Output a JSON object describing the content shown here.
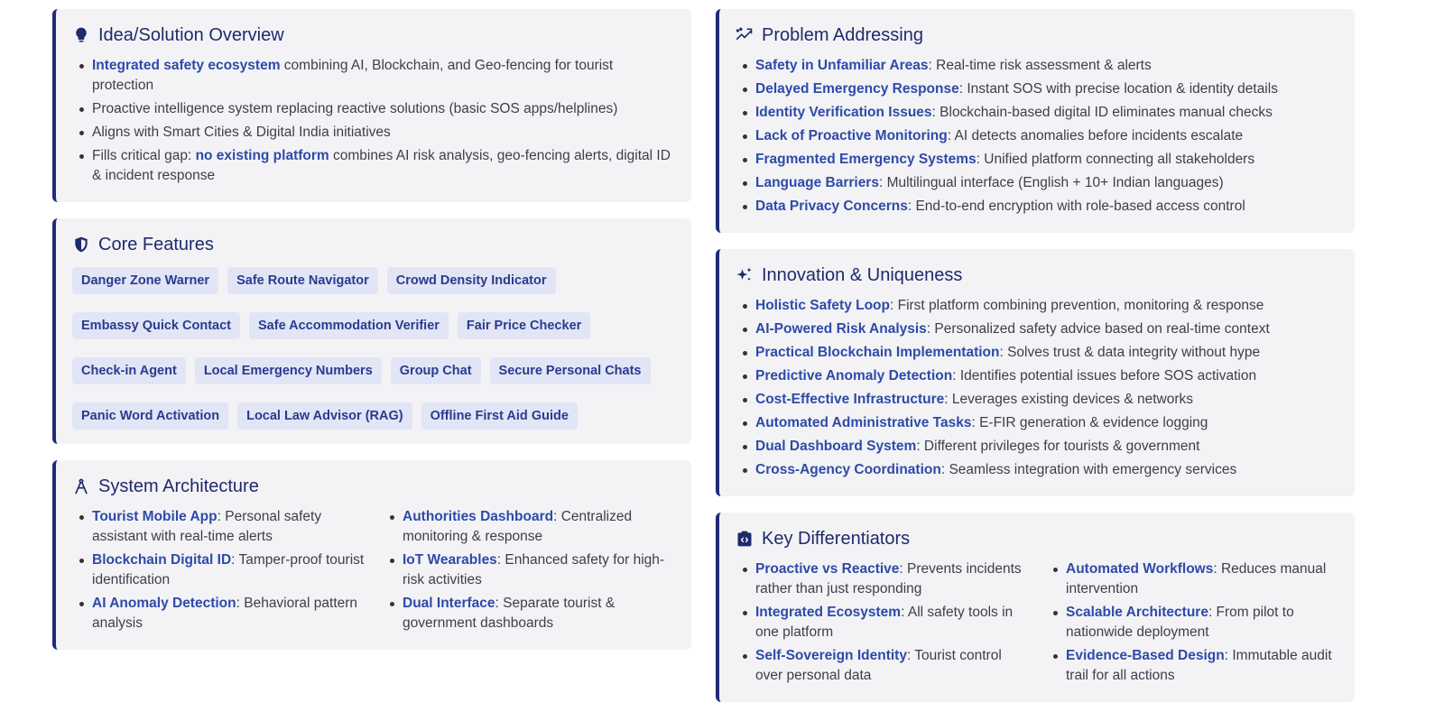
{
  "idea": {
    "title": "Idea/Solution Overview",
    "icon": "lightbulb-icon",
    "items": [
      {
        "hl": "Integrated safety ecosystem",
        "pre": "",
        "post": " combining AI, Blockchain, and Geo-fencing for tourist protection"
      },
      {
        "hl": "",
        "pre": "Proactive intelligence system replacing reactive solutions (basic SOS apps/helplines)",
        "post": ""
      },
      {
        "hl": "",
        "pre": "Aligns with Smart Cities & Digital India initiatives",
        "post": ""
      },
      {
        "hl": "no existing platform",
        "pre": "Fills critical gap: ",
        "post": " combines AI risk analysis, geo-fencing alerts, digital ID & incident response"
      }
    ]
  },
  "features": {
    "title": "Core Features",
    "icon": "shield-icon",
    "tags": [
      "Danger Zone Warner",
      "Safe Route Navigator",
      "Crowd Density Indicator",
      "Embassy Quick Contact",
      "Safe Accommodation Verifier",
      "Fair Price Checker",
      "Check-in Agent",
      "Local Emergency Numbers",
      "Group Chat",
      "Secure Personal Chats",
      "Panic Word Activation",
      "Local Law Advisor (RAG)",
      "Offline First Aid Guide"
    ]
  },
  "architecture": {
    "title": "System Architecture",
    "icon": "compass-icon",
    "left": [
      {
        "hl": "Tourist Mobile App",
        "post": ": Personal safety assistant with real-time alerts"
      },
      {
        "hl": "Blockchain Digital ID",
        "post": ": Tamper-proof tourist identification"
      },
      {
        "hl": "AI Anomaly Detection",
        "post": ": Behavioral pattern analysis"
      }
    ],
    "right": [
      {
        "hl": "Authorities Dashboard",
        "post": ": Centralized monitoring & response"
      },
      {
        "hl": "IoT Wearables",
        "post": ": Enhanced safety for high-risk activities"
      },
      {
        "hl": "Dual Interface",
        "post": ": Separate tourist & government dashboards"
      }
    ]
  },
  "problem": {
    "title": "Problem Addressing",
    "icon": "trend-chart-icon",
    "items": [
      {
        "hl": "Safety in Unfamiliar Areas",
        "post": ": Real-time risk assessment & alerts"
      },
      {
        "hl": "Delayed Emergency Response",
        "post": ": Instant SOS with precise location & identity details"
      },
      {
        "hl": "Identity Verification Issues",
        "post": ": Blockchain-based digital ID eliminates manual checks"
      },
      {
        "hl": "Lack of Proactive Monitoring",
        "post": ": AI detects anomalies before incidents escalate"
      },
      {
        "hl": "Fragmented Emergency Systems",
        "post": ": Unified platform connecting all stakeholders"
      },
      {
        "hl": "Language Barriers",
        "post": ": Multilingual interface (English + 10+ Indian languages)"
      },
      {
        "hl": "Data Privacy Concerns",
        "post": ": End-to-end encryption with role-based access control"
      }
    ]
  },
  "innovation": {
    "title": "Innovation & Uniqueness",
    "icon": "sparkles-icon",
    "items": [
      {
        "hl": "Holistic Safety Loop",
        "post": ": First platform combining prevention, monitoring & response"
      },
      {
        "hl": "AI-Powered Risk Analysis",
        "post": ": Personalized safety advice based on real-time context"
      },
      {
        "hl": "Practical Blockchain Implementation",
        "post": ": Solves trust & data integrity without hype"
      },
      {
        "hl": "Predictive Anomaly Detection",
        "post": ": Identifies potential issues before SOS activation"
      },
      {
        "hl": "Cost-Effective Infrastructure",
        "post": ": Leverages existing devices & networks"
      },
      {
        "hl": "Automated Administrative Tasks",
        "post": ": E-FIR generation & evidence logging"
      },
      {
        "hl": "Dual Dashboard System",
        "post": ": Different privileges for tourists & government"
      },
      {
        "hl": "Cross-Agency Coordination",
        "post": ": Seamless integration with emergency services"
      }
    ]
  },
  "differentiators": {
    "title": "Key Differentiators",
    "icon": "clipboard-code-icon",
    "left": [
      {
        "hl": "Proactive vs Reactive",
        "post": ": Prevents incidents rather than just responding"
      },
      {
        "hl": "Integrated Ecosystem",
        "post": ": All safety tools in one platform"
      },
      {
        "hl": "Self-Sovereign Identity",
        "post": ": Tourist control over personal data"
      }
    ],
    "right": [
      {
        "hl": "Automated Workflows",
        "post": ": Reduces manual intervention"
      },
      {
        "hl": "Scalable Architecture",
        "post": ": From pilot to nationwide deployment"
      },
      {
        "hl": "Evidence-Based Design",
        "post": ": Immutable audit trail for all actions"
      }
    ]
  }
}
